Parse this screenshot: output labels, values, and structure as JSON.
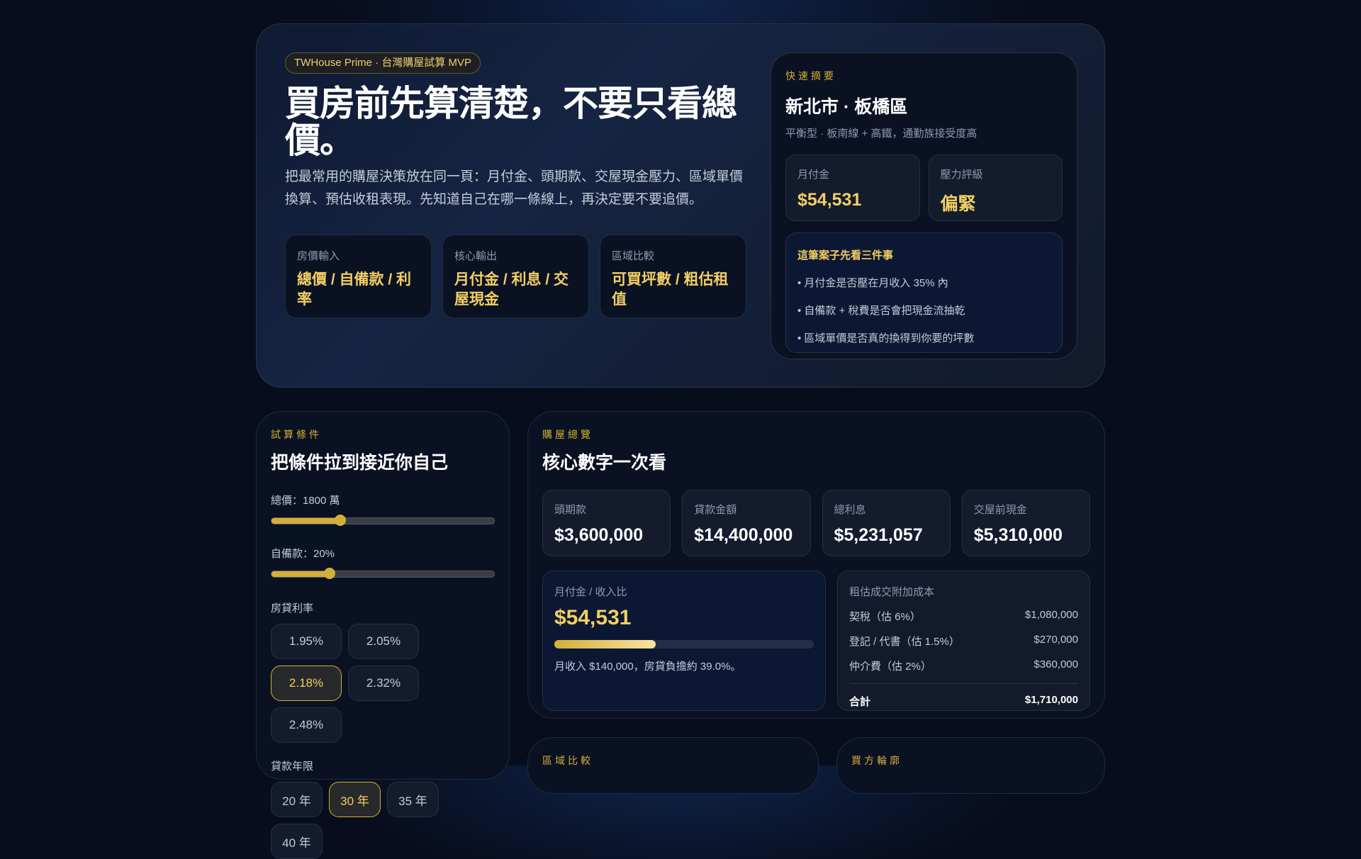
{
  "hero": {
    "badge": "TWHouse Prime · 台灣購屋試算 MVP",
    "title": "買房前先算清楚，不要只看總價。",
    "description": "把最常用的購屋決策放在同一頁：月付金、頭期款、交屋現金壓力、區域單價換算、預估收租表現。先知道自己在哪一條線上，再決定要不要追價。",
    "features": [
      {
        "label": "房價輸入",
        "value": "總價 / 自備款 / 利率"
      },
      {
        "label": "核心輸出",
        "value": "月付金 / 利息 / 交屋現金"
      },
      {
        "label": "區域比較",
        "value": "可買坪數 / 粗估租值"
      }
    ]
  },
  "summary": {
    "eyebrow": "快速摘要",
    "location": "新北市 · 板橋區",
    "subtitle": "平衡型 · 板南線 + 高鐵，通勤族接受度高",
    "monthly_label": "月付金",
    "monthly_value": "$54,531",
    "stress_label": "壓力評級",
    "stress_value": "偏緊",
    "checks_title": "這筆案子先看三件事",
    "checks": [
      "• 月付金是否壓在月收入 35% 內",
      "• 自備款 + 稅費是否會把現金流抽乾",
      "• 區域單價是否真的換得到你要的坪數"
    ]
  },
  "inputs": {
    "eyebrow": "試算條件",
    "title": "把條件拉到接近你自己",
    "price_label": "總價：1800 萬",
    "price_fraction": 0.31,
    "down_label": "自備款：20%",
    "down_fraction": 0.26,
    "rate_label": "房貸利率",
    "rates": [
      "1.95%",
      "2.05%",
      "2.18%",
      "2.32%",
      "2.48%"
    ],
    "rate_selected": 2,
    "term_label": "貸款年限",
    "terms": [
      "20 年",
      "30 年",
      "35 年",
      "40 年"
    ],
    "term_selected": 1
  },
  "overview": {
    "eyebrow": "購屋總覽",
    "title": "核心數字一次看",
    "kpis": [
      {
        "label": "頭期款",
        "value": "$3,600,000"
      },
      {
        "label": "貸款金額",
        "value": "$14,400,000"
      },
      {
        "label": "總利息",
        "value": "$5,231,057"
      },
      {
        "label": "交屋前現金",
        "value": "$5,310,000"
      }
    ],
    "ratio_label": "月付金 / 收入比",
    "ratio_value": "$54,531",
    "ratio_percent": 39.0,
    "ratio_note": "月收入 $140,000，房貸負擔約 39.0%。",
    "costs_title": "粗估成交附加成本",
    "costs": [
      {
        "label": "契稅（估 6%）",
        "value": "$1,080,000"
      },
      {
        "label": "登記 / 代書（估 1.5%）",
        "value": "$270,000"
      },
      {
        "label": "仲介費（估 2%）",
        "value": "$360,000"
      }
    ],
    "total_label": "合計",
    "total_value": "$1,710,000"
  },
  "sections": {
    "region_eyebrow": "區域比較",
    "buyer_eyebrow": "買方輪廓"
  }
}
